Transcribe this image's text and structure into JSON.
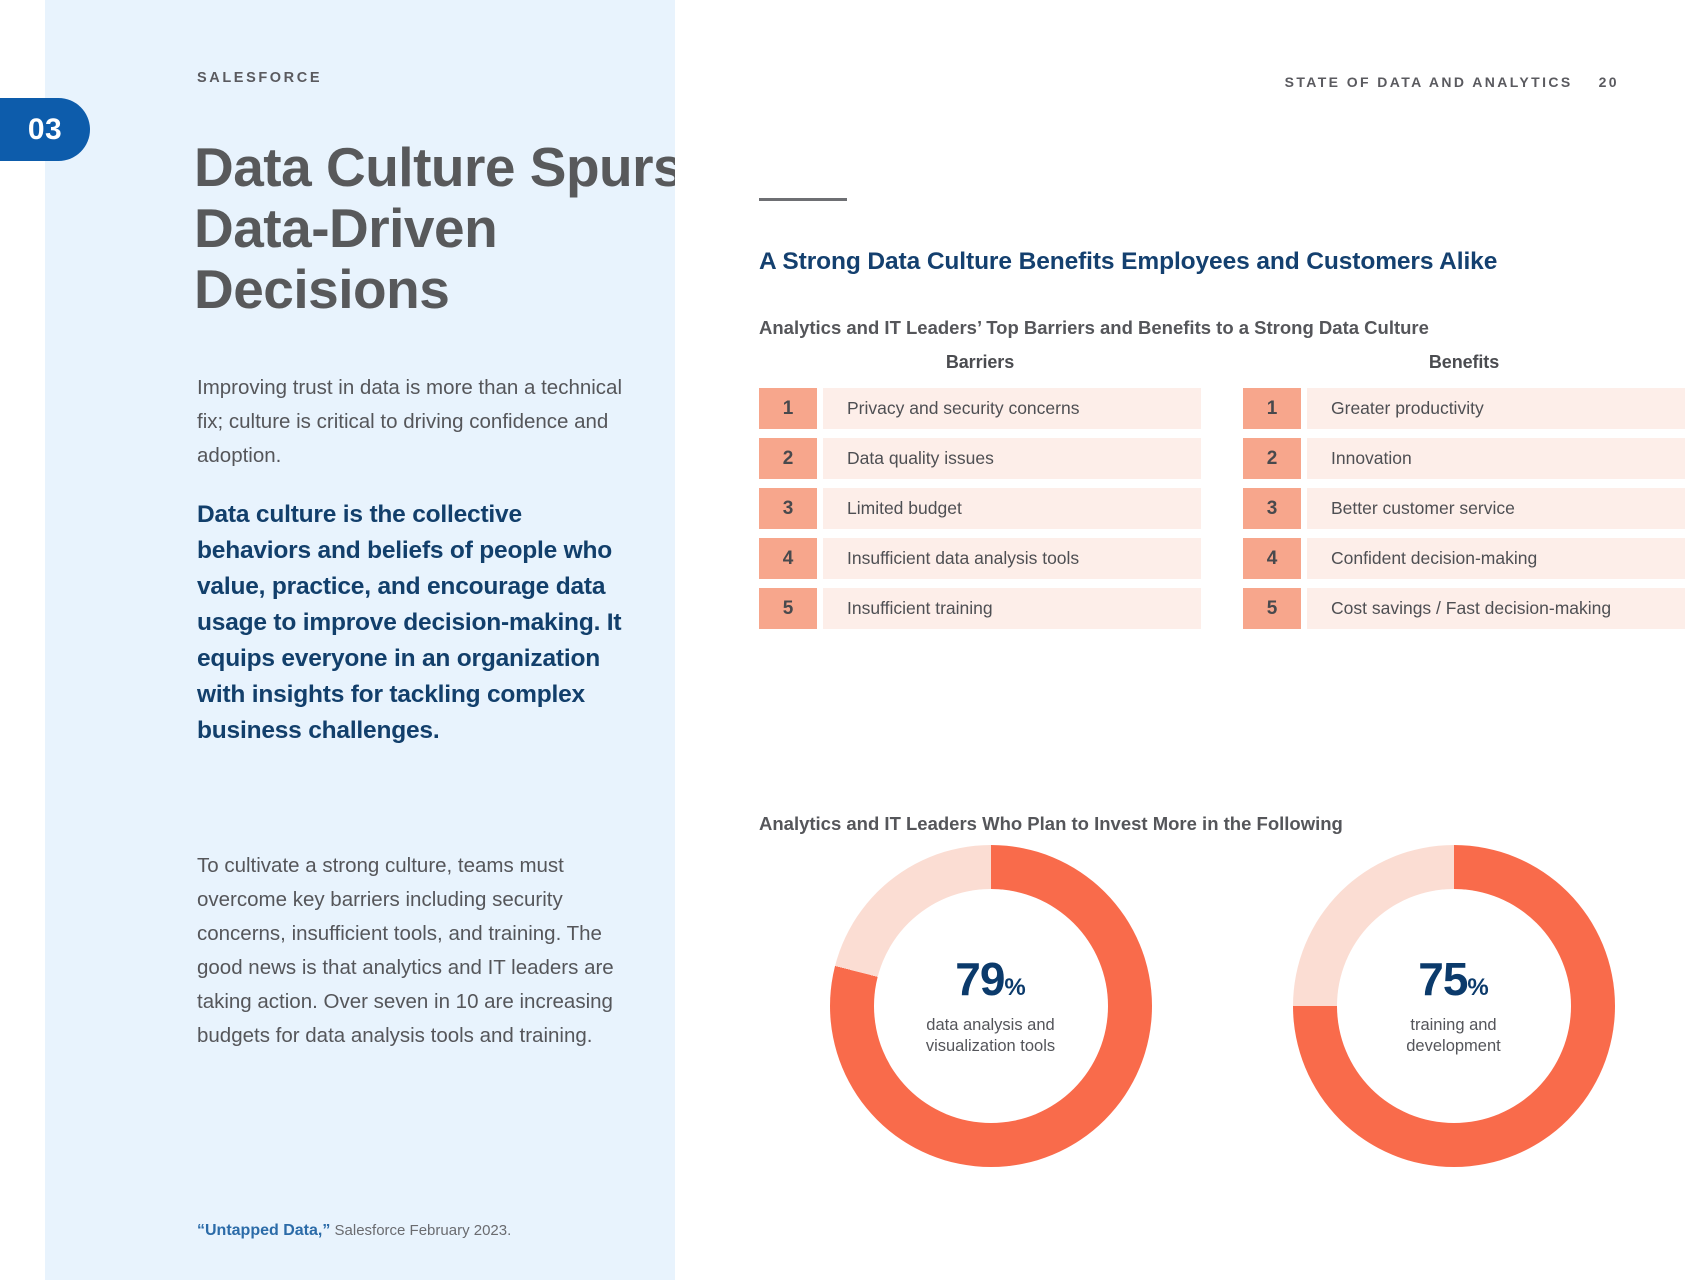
{
  "left": {
    "chapter_number": "03",
    "eyebrow": "SALESFORCE",
    "heading": "Data Culture Spurs Data-Driven Decisions",
    "paragraph_1": "Improving trust in data is more than a technical fix; culture is critical to driving confidence and adoption.",
    "pullquote": "Data culture is the collective behaviors and beliefs of people who value, practice, and encourage data usage to improve decision-making. It equips everyone in an organization with insights for tackling complex business challenges.",
    "paragraph_2": "To cultivate a strong culture, teams must overcome key barriers including security concerns, insufficient tools, and training. The good news is that analytics and IT leaders are taking action. Over seven in 10 are increasing budgets for data analysis tools and training.",
    "footnote_source": "“Untapped Data,”",
    "footnote_rest": " Salesforce February 2023."
  },
  "right": {
    "running_head": "STATE OF DATA AND ANALYTICS",
    "page_number": "20",
    "section_title": "A Strong Data Culture Benefits Employees and Customers Alike",
    "subhead_lists": "Analytics and IT Leaders’ Top Barriers and Benefits to a Strong Data Culture",
    "subhead_donuts": "Analytics and IT Leaders Who Plan to Invest More in the Following"
  },
  "chart_data": [
    {
      "type": "table",
      "title": "Analytics and IT Leaders’ Top Barriers and Benefits to a Strong Data Culture",
      "columns": [
        "Barriers",
        "Benefits"
      ],
      "rows": [
        {
          "rank": "1",
          "barrier": "Privacy and security concerns",
          "benefit": "Greater productivity"
        },
        {
          "rank": "2",
          "barrier": "Data quality issues",
          "benefit": "Innovation"
        },
        {
          "rank": "3",
          "barrier": "Limited budget",
          "benefit": "Better customer service"
        },
        {
          "rank": "4",
          "barrier": "Insufficient data analysis tools",
          "benefit": "Confident decision-making"
        },
        {
          "rank": "5",
          "barrier": "Insufficient training",
          "benefit": "Cost savings / Fast decision-making"
        }
      ]
    },
    {
      "type": "pie",
      "title": "Analytics and IT Leaders Who Plan to Invest More in the Following",
      "subtype": "donut",
      "legend": "none",
      "colors": {
        "filled": "#F96B4B",
        "remainder": "#FBDDD3"
      },
      "slices": [
        {
          "label": "data analysis and visualization tools",
          "value": 79,
          "unit": "%",
          "remainder": 21,
          "value_text": "79",
          "percent_symbol": "%",
          "caption_line_1": "data analysis and",
          "caption_line_2": "visualization tools"
        },
        {
          "label": "training and development",
          "value": 75,
          "unit": "%",
          "remainder": 25,
          "value_text": "75",
          "percent_symbol": "%",
          "caption_line_1": "training and",
          "caption_line_2": "development"
        }
      ]
    }
  ],
  "colors": {
    "panel_bg": "#E8F3FD",
    "brand_blue": "#0D5CAB",
    "heading_gray": "#58595B",
    "deep_navy": "#123F6B",
    "accent_orange": "#F96B4B",
    "rank_badge": "#F7A68C",
    "row_bg": "#FDEEE9"
  }
}
